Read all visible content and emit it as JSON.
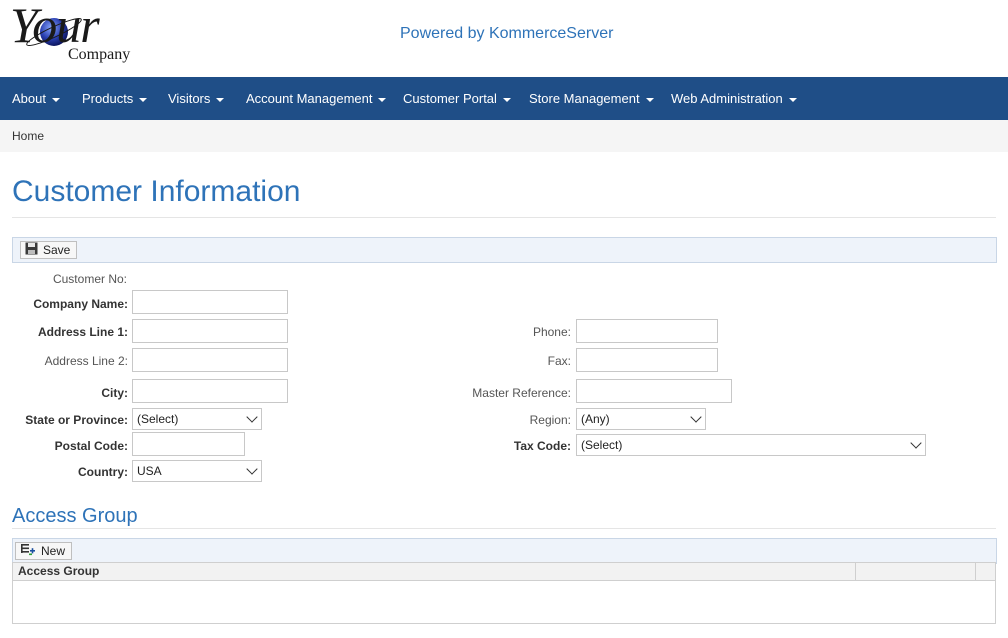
{
  "logo": {
    "text_main": "Your",
    "text_sub": "Company"
  },
  "header": {
    "powered_by": "Powered by KommerceServer"
  },
  "nav": {
    "items": [
      {
        "label": "About"
      },
      {
        "label": "Products"
      },
      {
        "label": "Visitors"
      },
      {
        "label": "Account Management"
      },
      {
        "label": "Customer Portal"
      },
      {
        "label": "Store Management"
      },
      {
        "label": "Web Administration"
      }
    ]
  },
  "breadcrumb": {
    "home": "Home"
  },
  "page": {
    "title": "Customer Information"
  },
  "toolbar": {
    "save_label": "Save"
  },
  "form": {
    "customer_no": {
      "label": "Customer No:",
      "value": ""
    },
    "company_name": {
      "label": "Company Name:",
      "value": ""
    },
    "address1": {
      "label": "Address Line 1:",
      "value": ""
    },
    "address2": {
      "label": "Address Line 2:",
      "value": ""
    },
    "city": {
      "label": "City:",
      "value": ""
    },
    "state": {
      "label": "State or Province:",
      "selected": "(Select)"
    },
    "postal_code": {
      "label": "Postal Code:",
      "value": ""
    },
    "country": {
      "label": "Country:",
      "selected": "USA"
    },
    "phone": {
      "label": "Phone:",
      "value": ""
    },
    "fax": {
      "label": "Fax:",
      "value": ""
    },
    "master_reference": {
      "label": "Master Reference:",
      "value": ""
    },
    "region": {
      "label": "Region:",
      "selected": "(Any)"
    },
    "tax_code": {
      "label": "Tax Code:",
      "selected": "(Select)"
    }
  },
  "access_group": {
    "title": "Access Group",
    "new_label": "New",
    "columns": [
      "Access Group",
      "",
      ""
    ]
  },
  "colors": {
    "nav_bg": "#1f4e87",
    "accent": "#2e73b8"
  }
}
